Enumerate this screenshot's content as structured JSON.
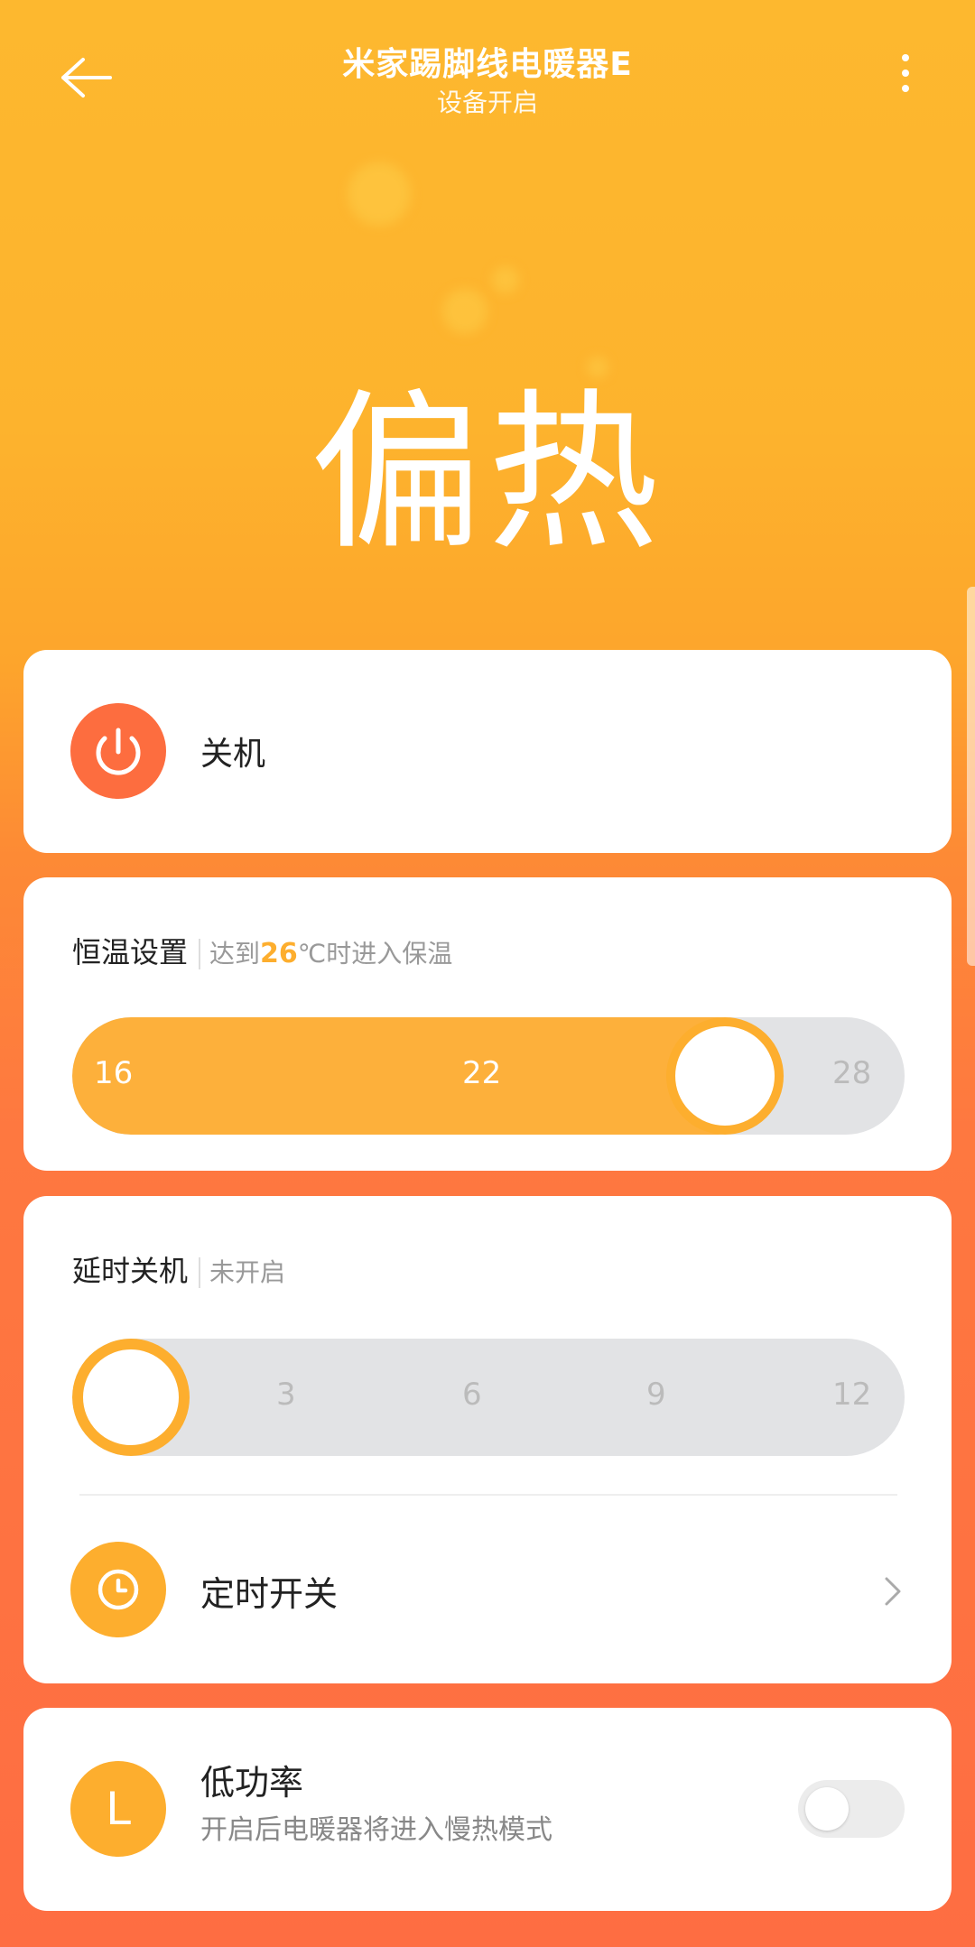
{
  "header": {
    "title": "米家踢脚线电暖器E",
    "subtitle": "设备开启"
  },
  "status": {
    "mode_text": "偏热"
  },
  "power_card": {
    "label": "关机"
  },
  "thermostat": {
    "title": "恒温设置",
    "note_prefix": "达到",
    "target_value": "26",
    "note_suffix": "℃时进入保温",
    "ticks": [
      "16",
      "22",
      "28"
    ],
    "value": 26,
    "min": 16,
    "max": 28
  },
  "delay_off": {
    "title": "延时关机",
    "status": "未开启",
    "ticks": [
      "3",
      "6",
      "9",
      "12"
    ],
    "value": 0
  },
  "timer": {
    "label": "定时开关"
  },
  "low_power": {
    "icon_letter": "L",
    "title": "低功率",
    "description": "开启后电暖器将进入慢热模式",
    "enabled": false
  },
  "colors": {
    "accent": "#fdae2e",
    "power_red": "#fd6d3f",
    "track_gray": "#e2e3e5"
  },
  "icons": [
    "back-arrow-icon",
    "more-vertical-icon",
    "power-icon",
    "clock-icon",
    "chevron-right-icon"
  ]
}
